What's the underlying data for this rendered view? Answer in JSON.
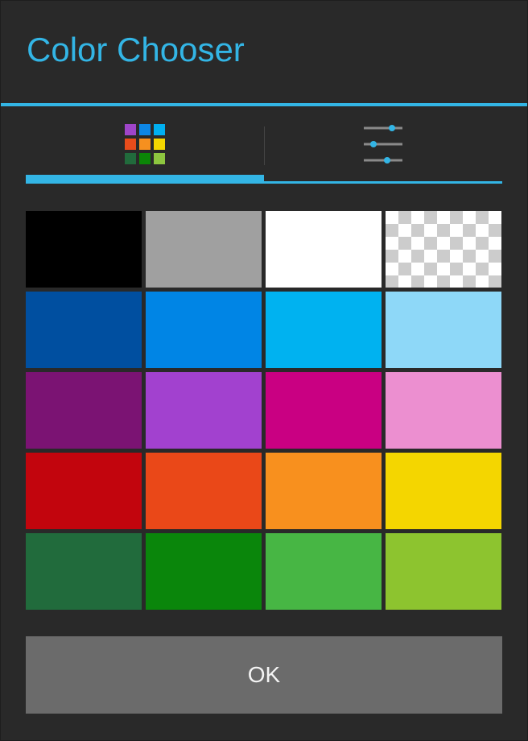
{
  "dialog": {
    "title": "Color Chooser",
    "accent": "#33b5e5",
    "ok_label": "OK"
  },
  "tabs": [
    {
      "icon": "swatch-grid-icon",
      "selected": true,
      "icon_colors": [
        "#9f45c9",
        "#0d86e5",
        "#00aff0",
        "#e84c1b",
        "#f6901f",
        "#f4d600",
        "#216b3c",
        "#0b8607",
        "#8dc63f"
      ]
    },
    {
      "icon": "sliders-icon",
      "selected": false
    }
  ],
  "swatches": [
    {
      "name": "black",
      "color": "#000000"
    },
    {
      "name": "gray",
      "color": "#a0a0a0"
    },
    {
      "name": "white",
      "color": "#ffffff"
    },
    {
      "name": "transparent",
      "color": "transparent"
    },
    {
      "name": "dark-blue",
      "color": "#004fa0"
    },
    {
      "name": "blue",
      "color": "#0085e5"
    },
    {
      "name": "cyan",
      "color": "#00b2f0"
    },
    {
      "name": "light-blue",
      "color": "#8ed8f8"
    },
    {
      "name": "dark-purple",
      "color": "#7b1373"
    },
    {
      "name": "purple",
      "color": "#a241cf"
    },
    {
      "name": "magenta",
      "color": "#c90082"
    },
    {
      "name": "pink",
      "color": "#ec8fd0"
    },
    {
      "name": "red",
      "color": "#c2050d"
    },
    {
      "name": "red-orange",
      "color": "#ea4818"
    },
    {
      "name": "orange",
      "color": "#f8901e"
    },
    {
      "name": "yellow",
      "color": "#f4d600"
    },
    {
      "name": "dark-green",
      "color": "#216b3c"
    },
    {
      "name": "green",
      "color": "#0a860b"
    },
    {
      "name": "light-green",
      "color": "#47b644"
    },
    {
      "name": "lime",
      "color": "#8dc42f"
    }
  ]
}
